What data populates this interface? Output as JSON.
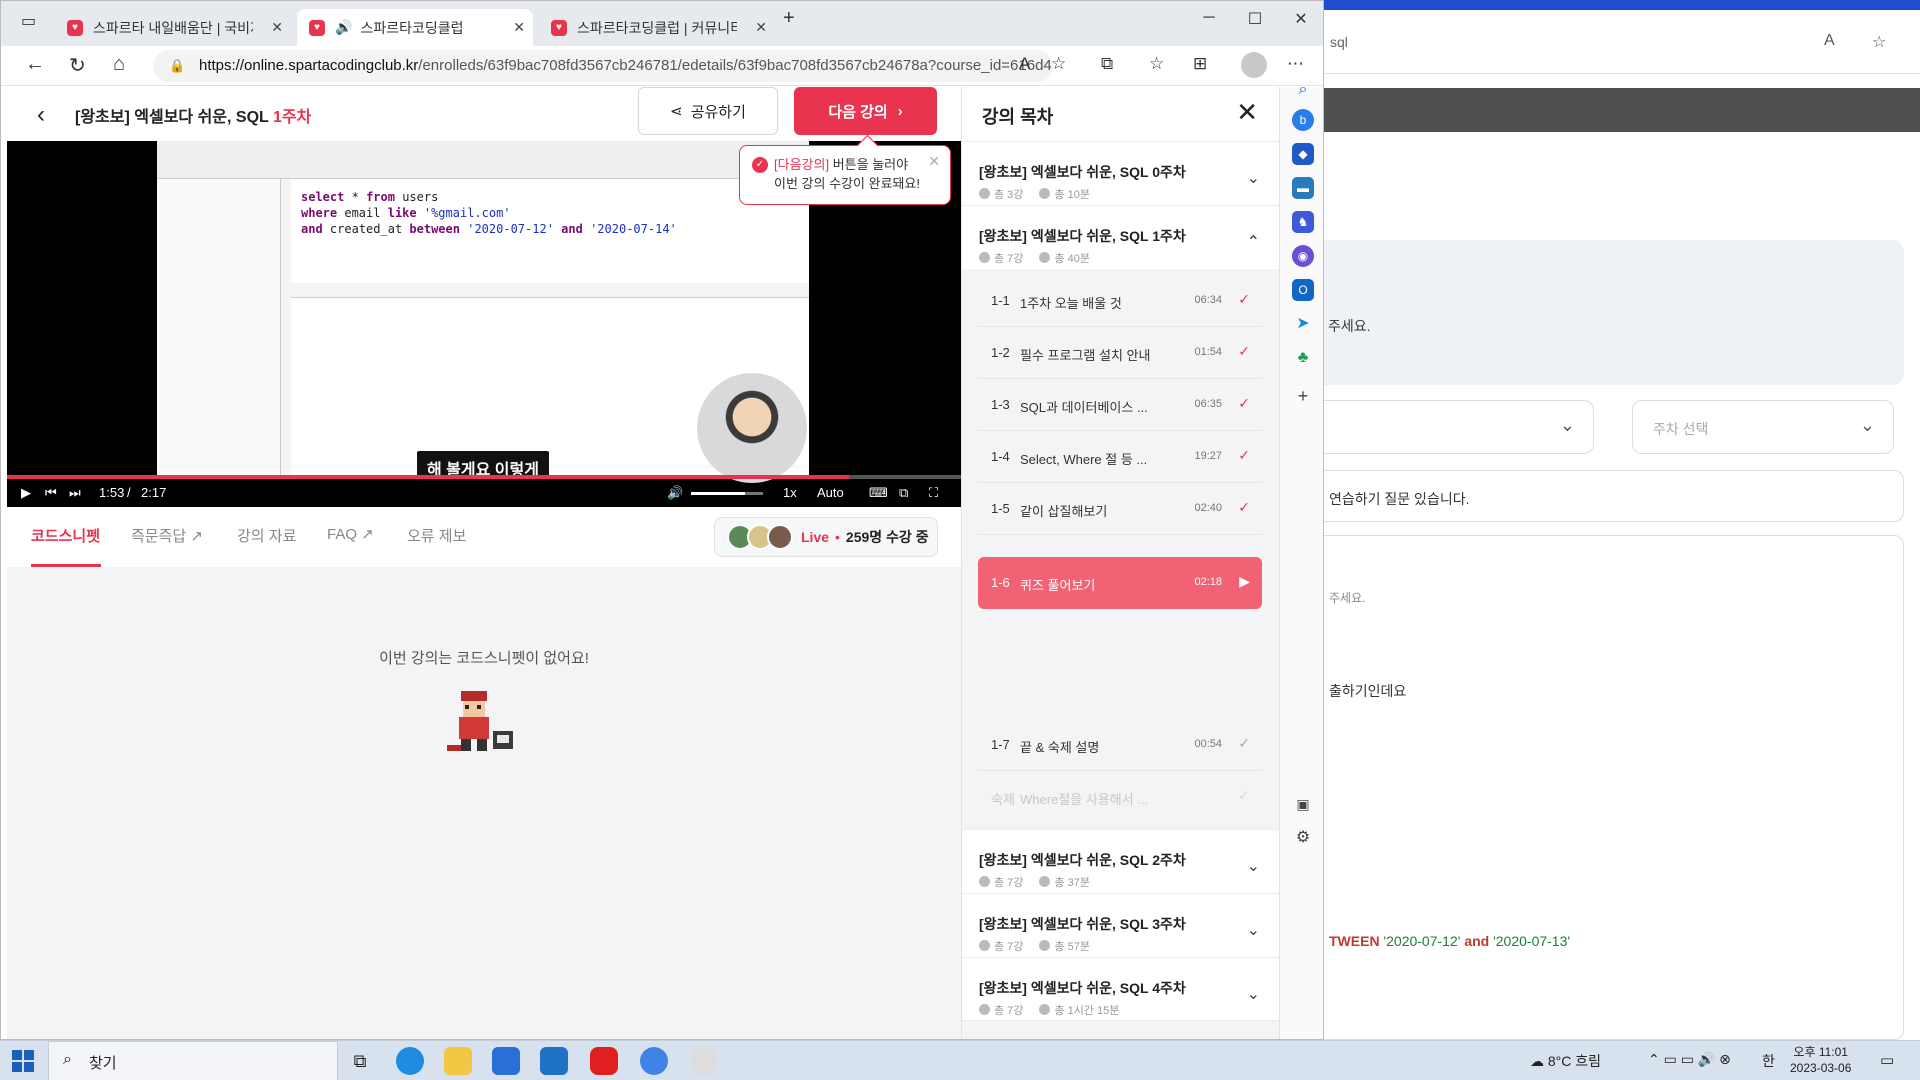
{
  "browser": {
    "tabs": [
      {
        "label": "스파르타 내일배움단 | 국비지원",
        "active": false
      },
      {
        "label": "스파르타코딩클럽",
        "active": true
      },
      {
        "label": "스파르타코딩클럽 | 커뮤니티",
        "active": false
      }
    ],
    "url_host": "https://online.spartacodingclub.kr",
    "url_path": "/enrolleds/63f9bac708fd3567cb246781/edetails/63f9bac708fd3567cb24678a?course_id=616d4..."
  },
  "background_window": {
    "url_fragment": "sql",
    "card1_text": "주세요.",
    "week_select_placeholder": "주차 선택",
    "card2_text": "연습하기 질문 있습니다.",
    "card3_small": "주세요.",
    "card3_text": "출하기인데요",
    "code_kw": "TWEEN",
    "code_str1": "'2020-07-12'",
    "code_and": "and",
    "code_str2": "'2020-07-13'"
  },
  "lecture": {
    "title": "[왕초보] 엑셀보다 쉬운, SQL",
    "week": "1주차",
    "share_label": "공유하기",
    "next_label": "다음 강의",
    "tooltip_hl": "[다음강의]",
    "tooltip_rest": "버튼을 눌러야",
    "tooltip_line2": "이번 강의 수강이 완료돼요!"
  },
  "video": {
    "sql_line1": [
      "select",
      "*",
      "from",
      "users"
    ],
    "sql_line2": [
      "where",
      "email",
      "like",
      "'%gmail.com'"
    ],
    "sql_line3": [
      "and",
      "created_at",
      "between",
      "'2020-07-12'",
      "and",
      "'2020-07-14'"
    ],
    "subtitle": "해 볼게요 이렇게",
    "current_time": "1:53",
    "separator": "/",
    "duration": "2:17",
    "progress_fraction": 0.883,
    "speed": "1x",
    "quality": "Auto"
  },
  "lesson_tabs": {
    "items": [
      "코드스니펫",
      "즉문즉답",
      "강의 자료",
      "FAQ",
      "오류 제보"
    ],
    "live_label": "Live",
    "live_count": "259명 수강 중"
  },
  "snippet": {
    "empty_text": "이번 강의는 코드스니펫이 없어요!"
  },
  "toc": {
    "title": "강의 목차",
    "weeks": [
      {
        "title": "[왕초보] 엑셀보다 쉬운, SQL 0주차",
        "count": "총 3강",
        "time": "총 10분"
      },
      {
        "title": "[왕초보] 엑셀보다 쉬운, SQL 1주차",
        "count": "총 7강",
        "time": "총 40분"
      },
      {
        "title": "[왕초보] 엑셀보다 쉬운, SQL 2주차",
        "count": "총 7강",
        "time": "총 37분"
      },
      {
        "title": "[왕초보] 엑셀보다 쉬운, SQL 3주차",
        "count": "총 7강",
        "time": "총 57분"
      },
      {
        "title": "[왕초보] 엑셀보다 쉬운, SQL 4주차",
        "count": "총 7강",
        "time": "총 1시간 15분"
      }
    ],
    "lessons": [
      {
        "num": "1-1",
        "title": "1주차 오늘 배울 것",
        "duration": "06:34"
      },
      {
        "num": "1-2",
        "title": "필수 프로그램 설치 안내",
        "duration": "01:54"
      },
      {
        "num": "1-3",
        "title": "SQL과 데이터베이스 ...",
        "duration": "06:35"
      },
      {
        "num": "1-4",
        "title": "Select, Where 절 등 ...",
        "duration": "19:27"
      },
      {
        "num": "1-5",
        "title": "같이 삽질해보기",
        "duration": "02:40"
      },
      {
        "num": "1-6",
        "title": "퀴즈 풀어보기",
        "duration": "02:18"
      },
      {
        "num": "1-7",
        "title": "끝 & 숙제 설명",
        "duration": "00:54"
      },
      {
        "num": "숙제",
        "title": "Where절을 사용해서 ...",
        "duration": ""
      }
    ]
  },
  "taskbar": {
    "search_label": "찾기",
    "weather": "8°C 흐림",
    "time": "오후 11:01",
    "date": "2023-03-06",
    "ime": "한"
  },
  "colors": {
    "accent": "#e8344e",
    "current_lesson": "#f06274"
  }
}
